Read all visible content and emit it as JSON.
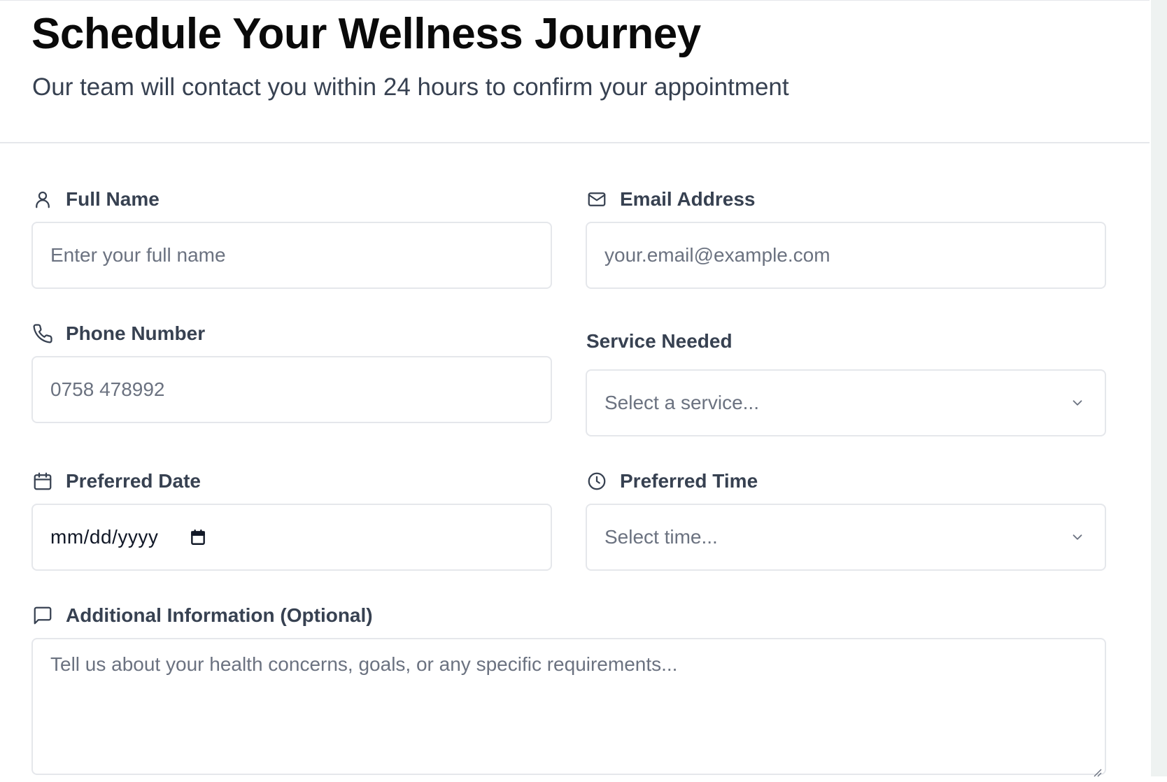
{
  "header": {
    "title": "Schedule Your Wellness Journey",
    "subtitle": "Our team will contact you within 24 hours to confirm your appointment"
  },
  "form": {
    "full_name": {
      "label": "Full Name",
      "icon": "user-icon",
      "placeholder": "Enter your full name"
    },
    "email": {
      "label": "Email Address",
      "icon": "mail-icon",
      "placeholder": "your.email@example.com"
    },
    "phone": {
      "label": "Phone Number",
      "icon": "phone-icon",
      "placeholder": "0758 478992"
    },
    "service": {
      "label": "Service Needed",
      "selected": "Select a service..."
    },
    "date": {
      "label": "Preferred Date",
      "icon": "calendar-icon",
      "value": "mm/dd/yyyy"
    },
    "time": {
      "label": "Preferred Time",
      "icon": "clock-icon",
      "selected": "Select time..."
    },
    "additional": {
      "label": "Additional Information (Optional)",
      "icon": "message-icon",
      "placeholder": "Tell us about your health concerns, goals, or any specific requirements..."
    }
  },
  "colors": {
    "title": "#0a0a0a",
    "label": "#374151",
    "placeholder": "#6b7280",
    "border": "#e5e7eb"
  }
}
